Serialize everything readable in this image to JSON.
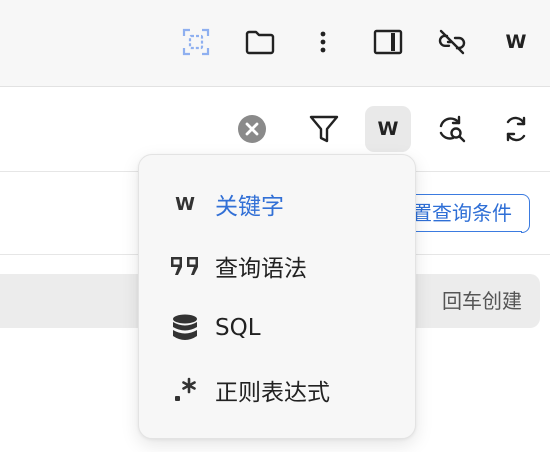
{
  "top_toolbar": {
    "icons": [
      "selection-icon",
      "folder-icon",
      "more-vertical-icon",
      "panel-right-icon",
      "unlink-icon",
      "w-icon"
    ],
    "w_label": "W",
    "accent_color": "#8fb0f0"
  },
  "filter_toolbar": {
    "icons": [
      "clear-icon",
      "filter-icon",
      "w-icon",
      "search-refresh-icon",
      "refresh-icon"
    ],
    "w_label": "W"
  },
  "query_condition": {
    "label": "置查询条件"
  },
  "create_row": {
    "hint": "回车创建"
  },
  "dropdown": {
    "items": [
      {
        "icon": "w-icon",
        "icon_text": "W",
        "label": "关键字",
        "active": true
      },
      {
        "icon": "quote-icon",
        "label": "查询语法",
        "active": false
      },
      {
        "icon": "database-icon",
        "label": "SQL",
        "active": false
      },
      {
        "icon": "regex-icon",
        "label": "正则表达式",
        "active": false
      }
    ],
    "active_color": "#3270d6"
  }
}
